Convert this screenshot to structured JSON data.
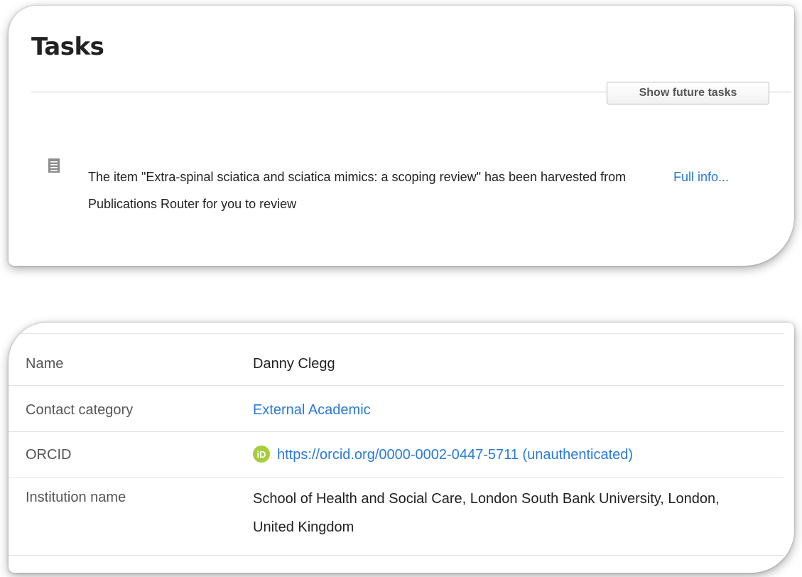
{
  "tasks": {
    "title": "Tasks",
    "show_future_label": "Show future tasks",
    "items": [
      {
        "icon": "document-icon",
        "text": "The item \"Extra-spinal sciatica and sciatica mimics: a scoping review\" has been harvested from Publications Router for you to review",
        "link_label": "Full info..."
      }
    ]
  },
  "contact": {
    "rows": [
      {
        "label": "Name",
        "value": "Danny Clegg"
      },
      {
        "label": "Contact category",
        "value": "External Academic"
      },
      {
        "label": "ORCID",
        "value": "https://orcid.org/0000-0002-0447-5711 (unauthenticated)",
        "icon": "orcid-icon",
        "icon_text": "iD"
      },
      {
        "label": "Institution name",
        "value": "School of Health and Social Care, London South Bank University, London, United Kingdom"
      }
    ]
  },
  "colors": {
    "link": "#2a7ad4",
    "orcid": "#a6ce39",
    "text": "#222222",
    "label": "#555555"
  }
}
